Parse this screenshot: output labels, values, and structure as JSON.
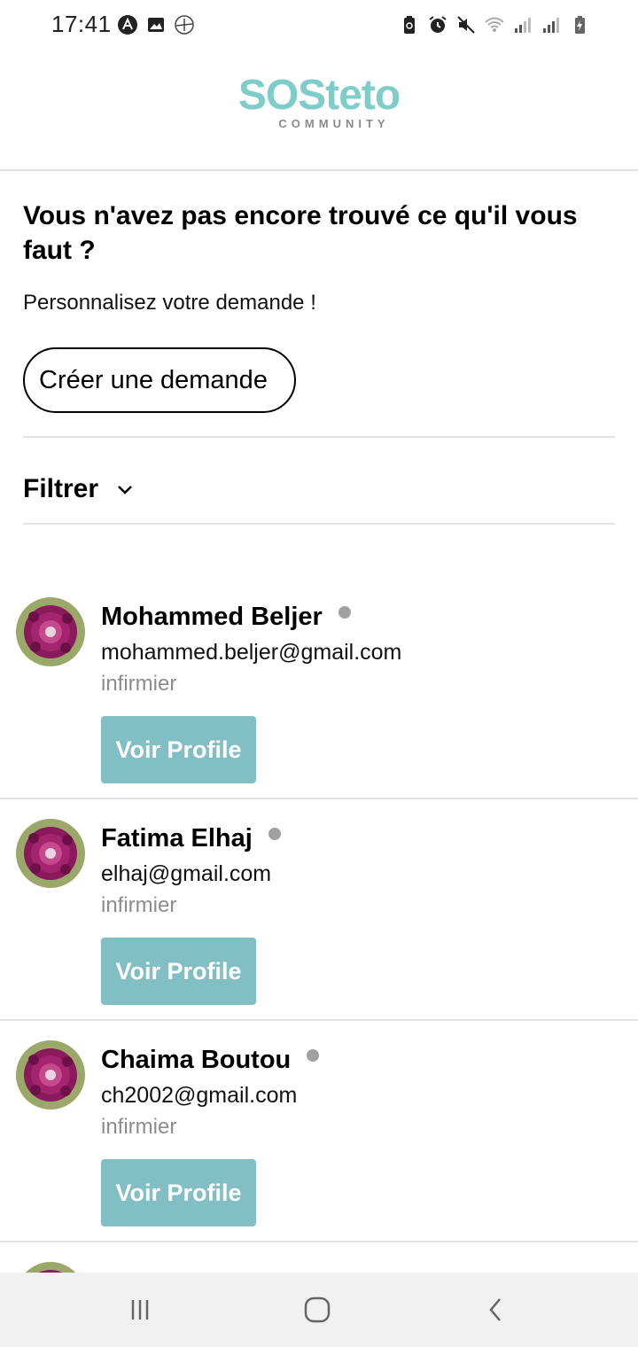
{
  "status_bar": {
    "time": "17:41",
    "left_icons": [
      "app-a-icon",
      "gallery-icon",
      "aircraft-icon"
    ],
    "right_icons": [
      "battery-saver-icon",
      "alarm-icon",
      "mute-icon",
      "wifi-icon",
      "signal-icon",
      "signal-icon",
      "battery-charging-icon"
    ]
  },
  "header": {
    "logo_main": "SOSteto",
    "logo_sub": "COMMUNITY",
    "logo_color": "#7fcdc9"
  },
  "request": {
    "title": "Vous n'avez pas encore trouvé ce qu'il vous faut ?",
    "subtitle": "Personnalisez votre demande !",
    "create_button": "Créer une demande"
  },
  "filter": {
    "label": "Filtrer",
    "icon": "chevron-down-icon"
  },
  "users": [
    {
      "name": "Mohammed Beljer",
      "email": "mohammed.beljer@gmail.com",
      "role": "infirmier",
      "button": "Voir Profile"
    },
    {
      "name": "Fatima Elhaj",
      "email": "elhaj@gmail.com",
      "role": "infirmier",
      "button": "Voir Profile"
    },
    {
      "name": "Chaima Boutou",
      "email": "ch2002@gmail.com",
      "role": "infirmier",
      "button": "Voir Profile"
    }
  ],
  "colors": {
    "accent_button": "#82bfc5",
    "presence_offline": "#a0a0a0"
  },
  "nav": {
    "icons": [
      "recent-apps-icon",
      "home-icon",
      "back-icon"
    ]
  }
}
